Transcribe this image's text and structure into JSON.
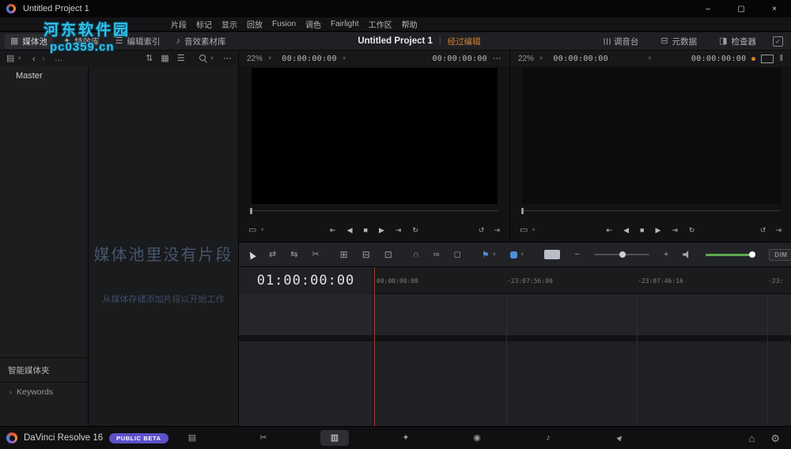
{
  "colors": {
    "accent_orange": "#d4822f",
    "watermark_cyan": "#35d1f5",
    "badge_purple": "#5c51c8",
    "flag_blue": "#4a90d8",
    "volume_green": "#5da84e",
    "playhead_red": "#a93a31"
  },
  "icons": {
    "minimize": "–",
    "maximize": "▢",
    "close": "×",
    "chevron": "∨",
    "panel": "▤",
    "back": "‹",
    "forward": "›",
    "ellipsis": "…",
    "more": "⋯",
    "sort": "⇅",
    "grid_view": "▦",
    "list_view": "☰",
    "media_pool": "▦",
    "effects": "✦",
    "edit_index": "☰",
    "sound_library": "♪",
    "mixer": "☰",
    "metadata": "⊟",
    "inspector": "◨",
    "check": "✓",
    "aspect": "▭",
    "skip_start": "⇤",
    "step_back": "◀",
    "stop": "■",
    "play": "▶",
    "skip_end": "⇥",
    "loop": "↻",
    "loop_back": "↺",
    "trim": "⇄",
    "dyn_trim": "⇆",
    "razor": "✂",
    "insert": "⊞",
    "overwrite": "⊟",
    "replace": "⊡",
    "snap": "∩",
    "link": "∞",
    "lock": "◻",
    "flag": "⚑",
    "minus": "−",
    "plus": "+",
    "bars": "‖",
    "home": "⌂",
    "gear": "⚙",
    "keyword_chevron": "›",
    "page_media": "▤",
    "page_cut": "✂",
    "page_edit": "▥",
    "page_fusion": "✦",
    "page_color": "◉",
    "page_fairlight": "♪",
    "page_deliver": "▲"
  },
  "titlebar": {
    "title": "Untitled Project 1"
  },
  "watermark": {
    "line1": "河东软件园",
    "line2": "pc0359.cn"
  },
  "menubar": {
    "items": [
      "片段",
      "标记",
      "显示",
      "回放",
      "Fusion",
      "调色",
      "Fairlight",
      "工作区",
      "帮助"
    ]
  },
  "toolbar": {
    "media_pool": "媒体池",
    "effects_library": "特效库",
    "edit_index": "编辑索引",
    "sound_library": "音效素材库",
    "project_title": "Untitled Project 1",
    "divider": "|",
    "project_status": "经过编辑",
    "mixer": "调音台",
    "metadata": "元数据",
    "inspector": "检查器"
  },
  "media_pool": {
    "master": "Master",
    "empty_title": "媒体池里没有片段",
    "empty_subtitle": "从媒体存储添加片段以开始工作",
    "smart_bins": "智能媒体夹",
    "keywords": "Keywords"
  },
  "source_viewer": {
    "zoom": "22%",
    "timecode": "00:00:00:00",
    "timecode_right": "00:00:00:00"
  },
  "timeline_viewer": {
    "zoom": "22%",
    "timecode": "00:00:00:00",
    "timecode_right": "00:00:00:00"
  },
  "timeline": {
    "playhead_timecode": "01:00:00:00",
    "ruler_labels": [
      "00:00:00:00",
      "-23:07:56:00",
      "-23:07:46:16",
      "-23:"
    ],
    "dim_label": "DIM"
  },
  "statusbar": {
    "app_name": "DaVinci Resolve 16",
    "badge": "PUBLIC BETA",
    "pages": [
      "media",
      "cut",
      "edit",
      "fusion",
      "color",
      "fairlight",
      "deliver"
    ],
    "active_page": "edit"
  }
}
